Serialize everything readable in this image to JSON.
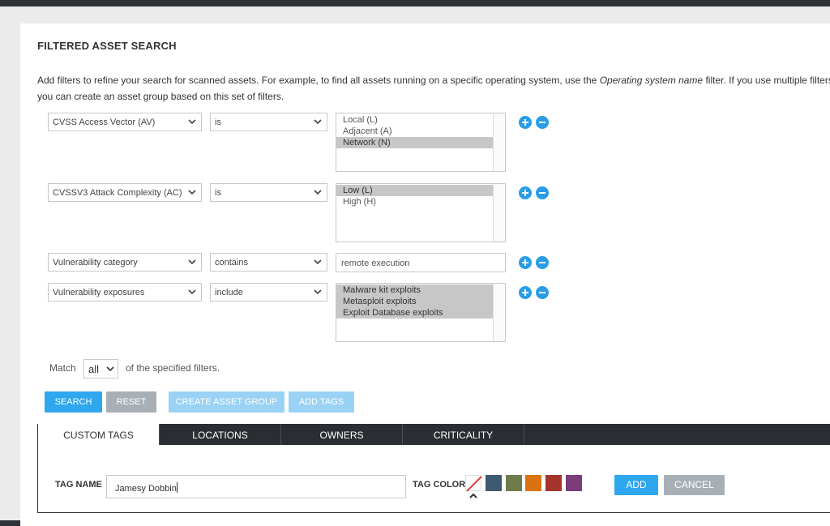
{
  "dialog": {
    "title": "FILTERED ASSET SEARCH",
    "description_pre": "Add filters to refine your search for scanned assets. For example, to find all assets running on a specific operating system, use the",
    "description_em": "Operating system name",
    "description_post": "filter. If you use multiple filters",
    "description_line2": "you can create an asset group based on this set of filters."
  },
  "filters": [
    {
      "field": "CVSS Access Vector (AV)",
      "operator": "is",
      "options": [
        {
          "label": "Local (L)",
          "selected": false
        },
        {
          "label": "Adjacent (A)",
          "selected": false
        },
        {
          "label": "Network (N)",
          "selected": true
        }
      ]
    },
    {
      "field": "CVSSV3 Attack Complexity (AC)",
      "operator": "is",
      "options": [
        {
          "label": "Low (L)",
          "selected": true
        },
        {
          "label": "High (H)",
          "selected": false
        }
      ]
    },
    {
      "field": "Vulnerability category",
      "operator": "contains",
      "value": "remote execution"
    },
    {
      "field": "Vulnerability exposures",
      "operator": "include",
      "options": [
        {
          "label": "Malware kit exploits",
          "selected": true
        },
        {
          "label": "Metasploit exploits",
          "selected": true
        },
        {
          "label": "Exploit Database exploits",
          "selected": true
        }
      ]
    }
  ],
  "match": {
    "prefix": "Match",
    "value": "all",
    "suffix": "of the specified filters."
  },
  "buttons": {
    "search": "SEARCH",
    "reset": "RESET",
    "create_group": "CREATE ASSET GROUP",
    "add_tags": "ADD TAGS"
  },
  "tabs": [
    "CUSTOM TAGS",
    "LOCATIONS",
    "OWNERS",
    "CRITICALITY"
  ],
  "tag_form": {
    "name_label": "TAG NAME",
    "name_value": "Jamesy Dobbin",
    "color_label": "TAG COLOR",
    "colors": [
      "#3d5a70",
      "#6e7b4a",
      "#d9730f",
      "#a5342a",
      "#7a3d7a"
    ],
    "add": "ADD",
    "cancel": "CANCEL"
  },
  "icons": {
    "add": "plus-circle-icon",
    "remove": "minus-circle-icon",
    "dropdown": "chevron-down-icon",
    "no_color": "no-color-icon",
    "selected_color": "chevron-up-icon"
  },
  "colors": {
    "accent": "#2ea7ef",
    "neutral_button": "#a8b0b7",
    "tab_bar": "#2a2e33",
    "selected_option": "#c7c7c7"
  }
}
